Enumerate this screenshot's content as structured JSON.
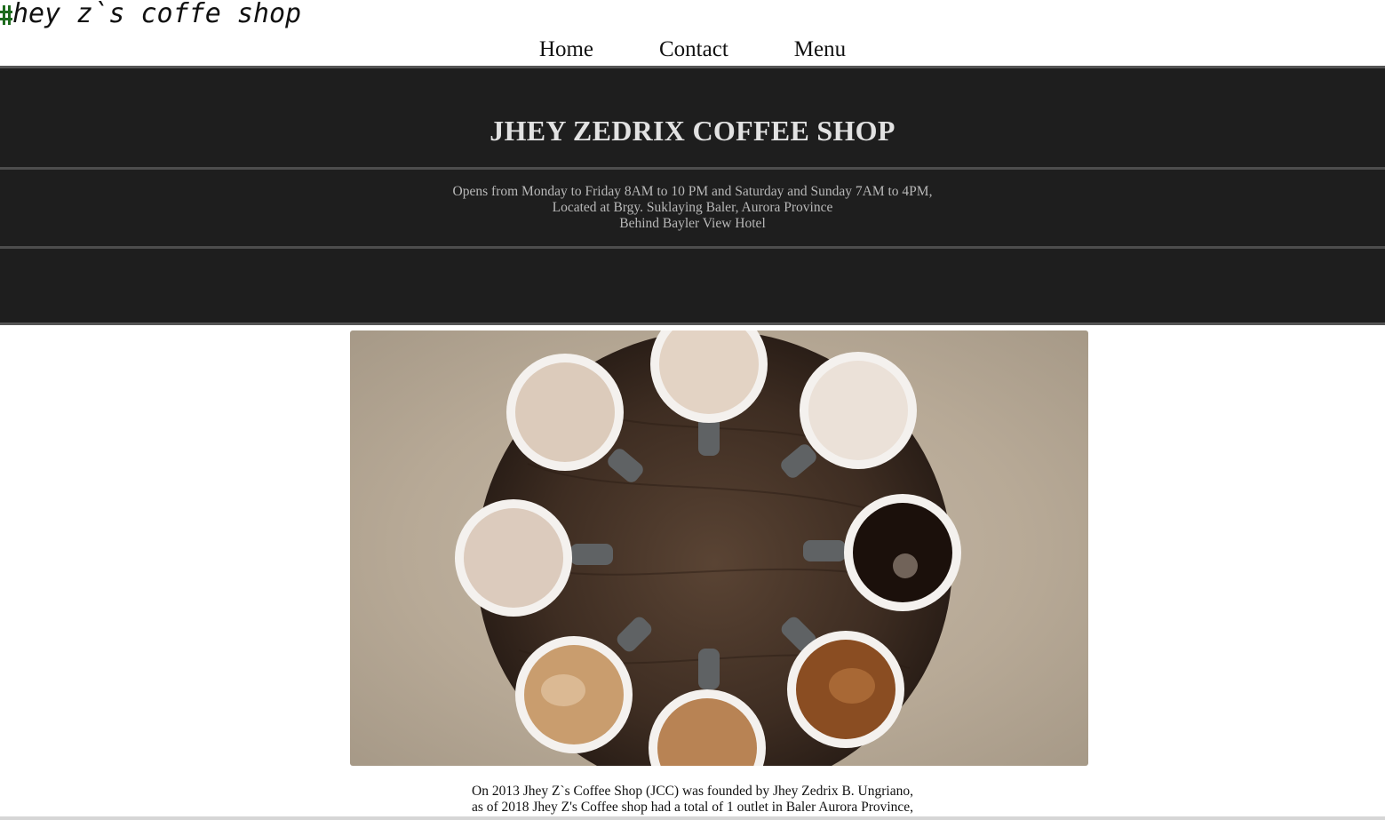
{
  "header": {
    "site_title": "hey z`s coffe shop",
    "logo_icon": "hash-icon"
  },
  "nav": {
    "items": [
      {
        "label": "Home"
      },
      {
        "label": "Contact"
      },
      {
        "label": "Menu"
      }
    ]
  },
  "hero": {
    "title": "JHEY ZEDRIX COFFEE SHOP",
    "hours_line1": "Opens from Monday to Friday 8AM to 10 PM and Saturday and Sunday 7AM to 4PM,",
    "hours_line2": "Located at Brgy. Suklaying Baler, Aurora Province",
    "hours_line3": "Behind Bayler View Hotel"
  },
  "photo": {
    "subject": "coffee-cups-on-round-table"
  },
  "about": {
    "line1": "On 2013 Jhey Z`s Coffee Shop (JCC) was founded by Jhey Zedrix B. Ungriano,",
    "line2": "as of 2018 Jhey Z's Coffee shop had a total of 1 outlet in Baler Aurora Province,"
  },
  "colors": {
    "hero_bg": "#1e1e1e",
    "hero_title": "#e2e2e2",
    "hero_text": "#b8b8b8",
    "logo_mark": "#1e6b1e"
  }
}
